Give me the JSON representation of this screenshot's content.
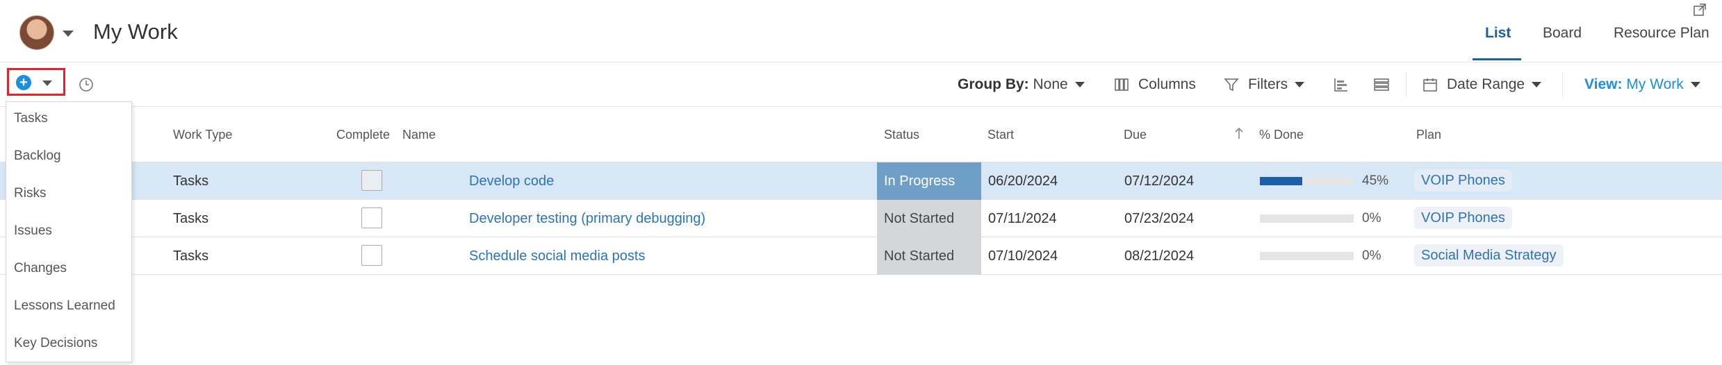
{
  "header": {
    "title": "My Work",
    "tabs": [
      {
        "label": "List",
        "active": true
      },
      {
        "label": "Board",
        "active": false
      },
      {
        "label": "Resource Plan",
        "active": false
      }
    ],
    "accent_color": "#1a5fa8"
  },
  "toolbar": {
    "group_by_label": "Group By:",
    "group_by_value": "None",
    "columns_label": "Columns",
    "filters_label": "Filters",
    "date_range_label": "Date Range",
    "view_label": "View:",
    "view_value": "My Work"
  },
  "add_menu": {
    "items": [
      "Tasks",
      "Backlog",
      "Risks",
      "Issues",
      "Changes",
      "Lessons Learned",
      "Key Decisions"
    ]
  },
  "table": {
    "columns": [
      "Work Type",
      "Complete",
      "Name",
      "Status",
      "Start",
      "Due",
      "% Done",
      "Plan"
    ],
    "rows": [
      {
        "work_type": "Tasks",
        "name": "Develop code",
        "status": "In Progress",
        "start": "06/20/2024",
        "due": "07/12/2024",
        "percent_done": 45,
        "percent_label": "45%",
        "plan": "VOIP Phones",
        "selected": true
      },
      {
        "work_type": "Tasks",
        "name": "Developer testing (primary debugging)",
        "status": "Not Started",
        "start": "07/11/2024",
        "due": "07/23/2024",
        "percent_done": 0,
        "percent_label": "0%",
        "plan": "VOIP Phones",
        "selected": false
      },
      {
        "work_type": "Tasks",
        "name": "Schedule social media posts",
        "status": "Not Started",
        "start": "07/10/2024",
        "due": "08/21/2024",
        "percent_done": 0,
        "percent_label": "0%",
        "plan": "Social Media Strategy",
        "selected": false
      }
    ]
  }
}
